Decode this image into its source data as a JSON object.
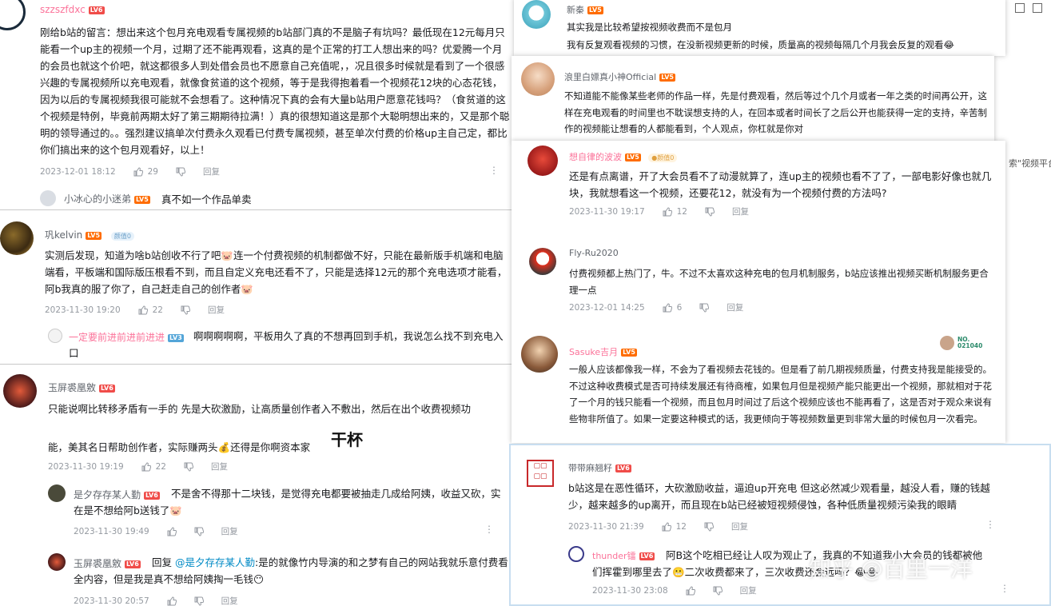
{
  "comments": [
    {
      "user": "szzszfdxc",
      "level": "LV6",
      "text": "刚给b站的留言：想出来这个包月充电观看专属视频的b站部门真的不是脑子有坑吗？最低现在12元每月只能看一个up主的视频一个月，过期了还不能再观看，这真的是个正常的打工人想出来的吗？优爱腾一个月的会员也就这个价吧，就这都很多人到处借会员也不愿意自己充值呢，，况且很多时候就是看到了一个很感兴趣的专属视频所以充电观看，就像食贫道的这个视频，等于是我得抱着看一个视频花12块的心态花钱，因为以后的专属视频我很可能就不会想看了。这种情况下真的会有大量b站用户愿意花钱吗？（食贫道的这个视频是特例，毕竟前两期太好了第三期期待拉满！）真的很想知道这是那个大聪明想出来的，又是那个聪明的领导通过的。。强烈建议搞单次付费永久观看已付费专属视频，甚至单次付费的价格up主自己定，都比你们搞出来的这个包月观看好，以上！",
      "date": "2023-12-01 18:12",
      "likes": "29",
      "reply_label": "回复",
      "sub": {
        "user": "小冰心的小迷弟",
        "level": "LV5",
        "text": "真不如一个作品单卖"
      }
    },
    {
      "user": "巩kelvin",
      "level": "LV5",
      "badge": "颜值0",
      "text": "实测后发现，知道为啥b站创收不行了吧🐷连一个付费视频的机制都做不好，只能在最新版手机端和电脑端看，平板端和国际版压根看不到，而且自定义充电还看不了，只能是选择12元的那个充电选项才能看，阿b我真的服了你了，自己赶走自己的创作者🐷",
      "date": "2023-11-30 19:20",
      "likes": "22",
      "reply_label": "回复",
      "sub": {
        "user": "一定要前进前进前进进",
        "level": "LV3",
        "text": "啊啊啊啊啊，平板用久了真的不想再回到手机，我说怎么找不到充电入口"
      }
    },
    {
      "user": "玉屏裘凰敫",
      "level": "LV6",
      "text_1": "只能说啊比转移矛盾有一手的 先是大砍激励，让高质量创作者入不敷出，然后在出个收费视频功",
      "text_2": "能，美其名日帮助创作者，实际赚两头💰还得是你啊资本家",
      "sticker": "干杯",
      "date": "2023-11-30 19:19",
      "likes": "22",
      "reply_label": "回复",
      "replies": [
        {
          "user": "是夕存存某人勤",
          "level": "LV6",
          "text": "不是舍不得那十二块钱，是觉得充电都要被抽走几成给阿姨，收益又砍，实在是不想给阿b送钱了🐷",
          "date": "2023-11-30 19:49",
          "reply_label": "回复"
        },
        {
          "user": "玉屏裘凰敫",
          "level": "LV6",
          "prefix": "回复",
          "mention": "@是夕存存某人勤",
          "text": ":是的就像竹内导演的和之梦有自己的网站我就乐意付费看全内容，但是我是真不想给阿姨掏一毛钱😶",
          "date": "2023-11-30 20:57",
          "reply_label": "回复"
        }
      ]
    }
  ],
  "right_comments": [
    {
      "user": "新秦",
      "level": "LV5",
      "line1": "其实我是比较希望按视频收费而不是包月",
      "line2": "我有反复观看视频的习惯，在没新视频更新的时候，质量高的视频每隔几个月我会反复的观看😂"
    },
    {
      "user": "浪里白嫖真小神Official",
      "level": "LV5",
      "text": "不知道能不能像某些老师的作品一样，先是付费观看，然后等过个几个月或者一年之类的时间再公开，这样在充电观看的时间里也不耽误想支持的人，在回本或者时间长了之后公开也能获得一定的支持，辛苦制作的视频能让想看的人都能看到，个人观点，你杠就是你对"
    },
    {
      "user": "想自律的波波",
      "level": "LV5",
      "badge": "颜值0",
      "text": "还是有点离谱，开了大会员看不了动漫就算了，连up主的视频也看不了了，一部电影好像也就几块，我就想看这一个视频，还要花12，就没有为一个视频付费的方法吗?",
      "date": "2023-11-30 19:17",
      "likes": "12",
      "reply_label": "回复"
    },
    {
      "user": "Fly-Ru2020",
      "level": "LV5",
      "text": "付费视频都上热门了，牛。不过不太喜欢这种充电的包月机制服务，b站应该推出视频买断机制服务更合理一点",
      "date": "2023-12-01 14:25",
      "likes": "6",
      "reply_label": "回复"
    },
    {
      "user": "Sasuke吉月",
      "level": "LV5",
      "fan_no": "NO.\n021040",
      "text": "一般人应该都像我一样，不会为了看视频去花钱的。但是看了前几期视频质量，付费支持我是能接受的。不过这种收费模式是否可持续发展还有待商榷，如果包月但是视频产能只能更出一个视频，那就相对于花了一个月的钱只能看一个视频，而且包月时间过了后这个视频应该也不能再看了，这是否对于观众来说有些物非所值了。如果一定要这种模式的话，我更倾向于等视频数量更到非常大量的时候包月一次看完。"
    },
    {
      "user": "带带麻翘籽",
      "level": "LV6",
      "text": "b站这是在恶性循环，大砍激励收益，逼迫up开充电 但这必然减少观看量，越没人看，赚的钱越少，越来越多的up离开，而且现在b站已经被短视频侵蚀，各种低质量视频污染我的眼睛",
      "date": "2023-11-30 21:39",
      "likes": "12",
      "reply_label": "回复",
      "sub": {
        "user": "thunder镭",
        "level": "LV6",
        "text": "阿B这个吃相已经让人叹为观止了，我真的不知道我小大会员的钱都被他们挥霍到哪里去了😬二次收费都来了，三次收费还会远吗？😂😂",
        "date": "2023-11-30 23:08",
        "reply_label": "回复"
      }
    }
  ],
  "background_snippet": "索\"视频平台",
  "watermark": "知乎 @百里一洋",
  "colors": {
    "name_pink": "#fb7299",
    "name_gray": "#61666d",
    "meta_gray": "#9499a0",
    "link_blue": "#008ac5"
  }
}
